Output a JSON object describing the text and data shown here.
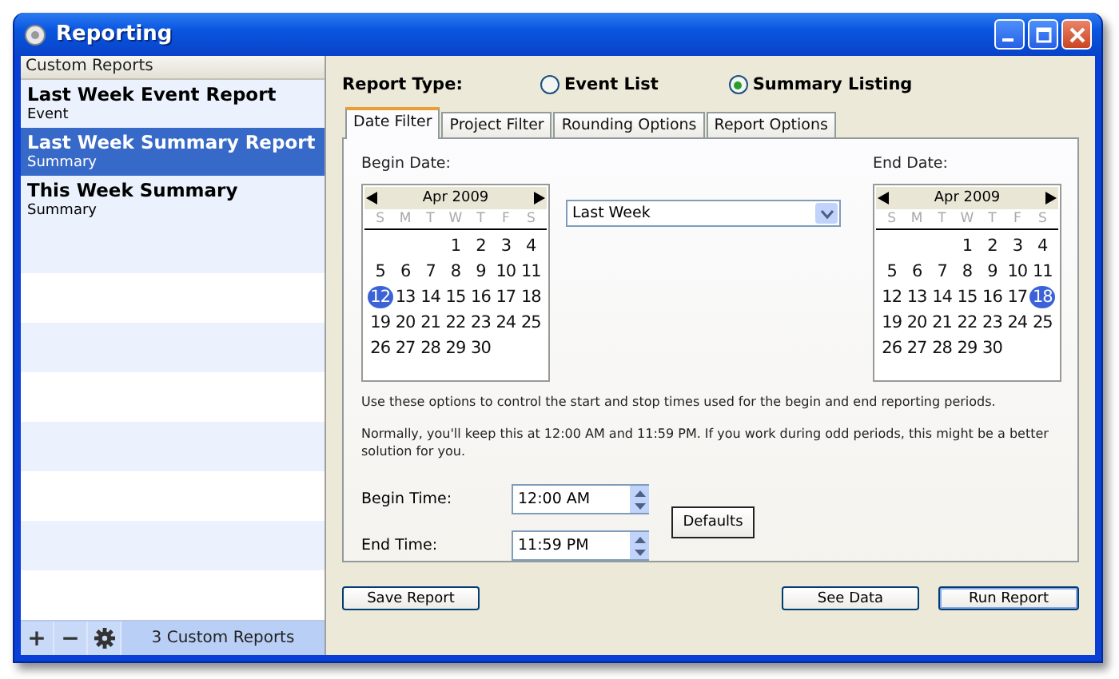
{
  "window": {
    "title": "Reporting"
  },
  "sidebar": {
    "header": "Custom Reports",
    "items": [
      {
        "title": "Last Week Event Report",
        "subtitle": "Event",
        "selected": false
      },
      {
        "title": "Last Week Summary Report",
        "subtitle": "Summary",
        "selected": true
      },
      {
        "title": "This Week Summary",
        "subtitle": "Summary",
        "selected": false
      }
    ],
    "footer": {
      "buttons": [
        {
          "kind": "add",
          "label": "+"
        },
        {
          "kind": "remove",
          "label": "−"
        },
        {
          "kind": "settings"
        }
      ],
      "count": "3 Custom Reports"
    }
  },
  "report_type": {
    "label": "Report Type:",
    "options": [
      {
        "label": "Event List",
        "selected": false
      },
      {
        "label": "Summary Listing",
        "selected": true
      }
    ]
  },
  "tabs": [
    {
      "label": "Date Filter",
      "selected": true
    },
    {
      "label": "Project Filter",
      "selected": false
    },
    {
      "label": "Rounding Options",
      "selected": false
    },
    {
      "label": "Report Options",
      "selected": false
    }
  ],
  "date_filter": {
    "begin": {
      "label": "Begin Date:",
      "calendar": {
        "month": "Apr 2009",
        "weekdays": [
          "S",
          "M",
          "T",
          "W",
          "T",
          "F",
          "S"
        ],
        "weeks": [
          [
            {
              "day": "1",
              "selected": false
            },
            {
              "day": "2",
              "selected": false
            },
            {
              "day": "3",
              "selected": false
            },
            {
              "day": "4",
              "selected": false
            }
          ],
          [
            {
              "day": "5",
              "selected": false
            },
            {
              "day": "6",
              "selected": false
            },
            {
              "day": "7",
              "selected": false
            },
            {
              "day": "8",
              "selected": false
            },
            {
              "day": "9",
              "selected": false
            },
            {
              "day": "10",
              "selected": false
            },
            {
              "day": "11",
              "selected": false
            }
          ],
          [
            {
              "day": "12",
              "selected": true
            },
            {
              "day": "13",
              "selected": false
            },
            {
              "day": "14",
              "selected": false
            },
            {
              "day": "15",
              "selected": false
            },
            {
              "day": "16",
              "selected": false
            },
            {
              "day": "17",
              "selected": false
            },
            {
              "day": "18",
              "selected": false
            }
          ],
          [
            {
              "day": "19",
              "selected": false
            },
            {
              "day": "20",
              "selected": false
            },
            {
              "day": "21",
              "selected": false
            },
            {
              "day": "22",
              "selected": false
            },
            {
              "day": "23",
              "selected": false
            },
            {
              "day": "24",
              "selected": false
            },
            {
              "day": "25",
              "selected": false
            }
          ],
          [
            {
              "day": "26",
              "selected": false
            },
            {
              "day": "27",
              "selected": false
            },
            {
              "day": "28",
              "selected": false
            },
            {
              "day": "29",
              "selected": false
            },
            {
              "day": "30",
              "selected": false
            }
          ]
        ]
      }
    },
    "range": {
      "value": "Last Week"
    },
    "end": {
      "label": "End Date:",
      "calendar": {
        "month": "Apr 2009",
        "weekdays": [
          "S",
          "M",
          "T",
          "W",
          "T",
          "F",
          "S"
        ],
        "weeks": [
          [
            {
              "day": "1",
              "selected": false
            },
            {
              "day": "2",
              "selected": false
            },
            {
              "day": "3",
              "selected": false
            },
            {
              "day": "4",
              "selected": false
            }
          ],
          [
            {
              "day": "5",
              "selected": false
            },
            {
              "day": "6",
              "selected": false
            },
            {
              "day": "7",
              "selected": false
            },
            {
              "day": "8",
              "selected": false
            },
            {
              "day": "9",
              "selected": false
            },
            {
              "day": "10",
              "selected": false
            },
            {
              "day": "11",
              "selected": false
            }
          ],
          [
            {
              "day": "12",
              "selected": false
            },
            {
              "day": "13",
              "selected": false
            },
            {
              "day": "14",
              "selected": false
            },
            {
              "day": "15",
              "selected": false
            },
            {
              "day": "16",
              "selected": false
            },
            {
              "day": "17",
              "selected": false
            },
            {
              "day": "18",
              "selected": true
            }
          ],
          [
            {
              "day": "19",
              "selected": false
            },
            {
              "day": "20",
              "selected": false
            },
            {
              "day": "21",
              "selected": false
            },
            {
              "day": "22",
              "selected": false
            },
            {
              "day": "23",
              "selected": false
            },
            {
              "day": "24",
              "selected": false
            },
            {
              "day": "25",
              "selected": false
            }
          ],
          [
            {
              "day": "26",
              "selected": false
            },
            {
              "day": "27",
              "selected": false
            },
            {
              "day": "28",
              "selected": false
            },
            {
              "day": "29",
              "selected": false
            },
            {
              "day": "30",
              "selected": false
            }
          ]
        ]
      }
    },
    "help": [
      "Use these options to control the start and stop times used for the begin and end reporting periods.",
      "Normally, you'll keep this at 12:00 AM and 11:59 PM.  If you work during odd periods, this might be a better solution for you."
    ],
    "times": [
      {
        "label": "Begin Time:",
        "value": "12:00 AM"
      },
      {
        "label": "End Time:",
        "value": "11:59 PM"
      }
    ],
    "defaults_button": "Defaults"
  },
  "buttons": {
    "left": [
      "Save Report"
    ],
    "right": [
      "See Data",
      "Run Report"
    ]
  }
}
